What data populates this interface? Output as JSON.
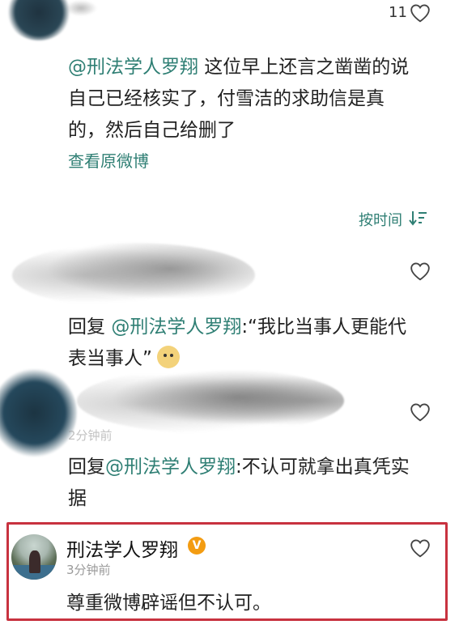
{
  "top_comment": {
    "like_count": "11",
    "mention": "@刑法学人罗翔",
    "text_part1": " 这位早上还言之凿凿的说",
    "text_part2": "自己已经核实了，付雪洁的求助信是真",
    "text_part3": "的，然后自己给删了",
    "view_original": "查看原微博"
  },
  "sort": {
    "label": "按时间",
    "icon": "sort-icon"
  },
  "reply1": {
    "prefix": "回复 ",
    "mention": "@刑法学人罗翔",
    "text_line1": ":“我比当事人更能代",
    "text_line2": "表当事人”",
    "emoji": "doge-emoji"
  },
  "reply2": {
    "time": "2分钟前",
    "prefix": "回复",
    "mention": "@刑法学人罗翔",
    "text_line1": ":不认可就拿出真凭实",
    "text_line2": "据"
  },
  "author_comment": {
    "name": "刑法学人罗翔",
    "verified_mark": "V",
    "time": "3分钟前",
    "text": "尊重微博辟谣但不认可。"
  },
  "colors": {
    "link": "#2f7f74",
    "highlight_border": "#c8323f",
    "verified_badge": "#f39c12"
  }
}
